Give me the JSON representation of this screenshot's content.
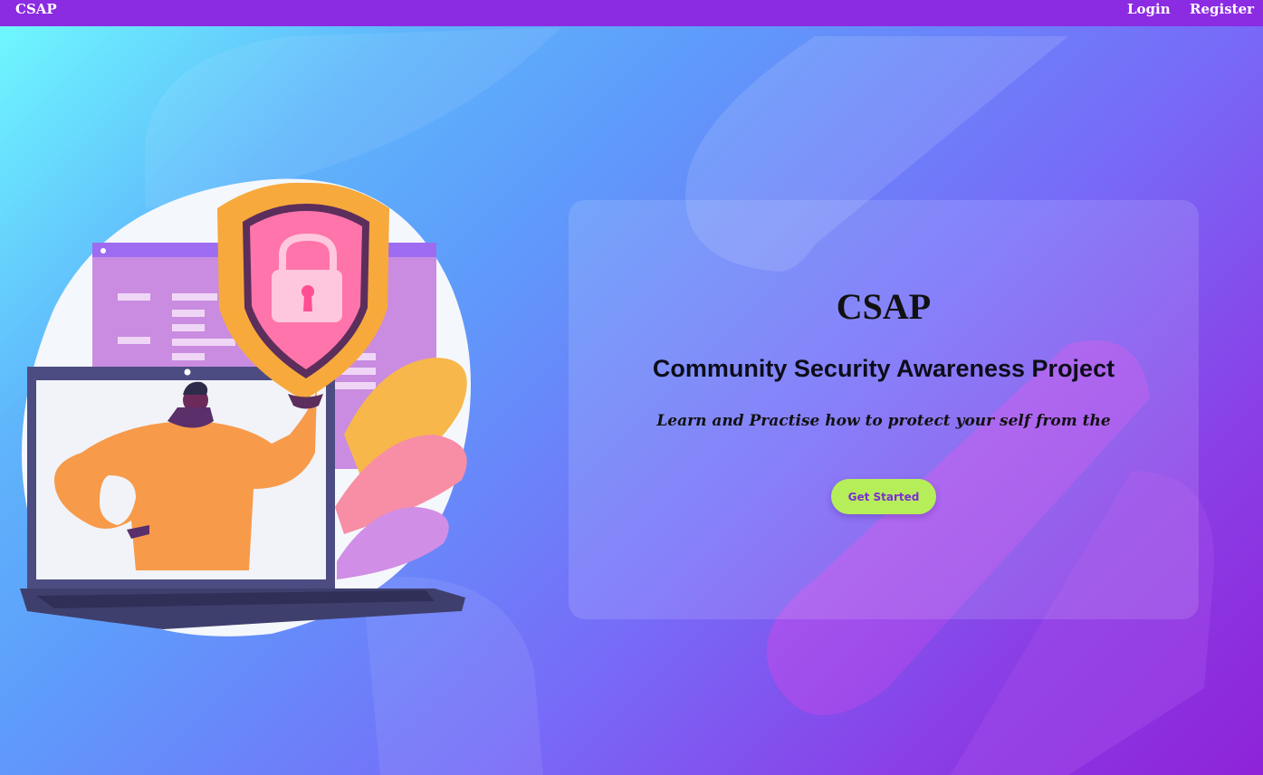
{
  "navbar": {
    "brand": "CSAP",
    "links": {
      "login": "Login",
      "register": "Register"
    }
  },
  "hero": {
    "title": "CSAP",
    "subtitle": "Community Security Awareness Project",
    "tagline": "Learn and Practise how to protect your self from the",
    "cta_label": "Get Started"
  },
  "illustration": {
    "icons": [
      "shield-icon",
      "padlock-icon",
      "laptop-icon",
      "person-icon",
      "leaf-icon"
    ]
  },
  "colors": {
    "navbar": "#8b2be2",
    "cta_bg": "#b6ee5a",
    "cta_text": "#7a2fd0",
    "shield_outer": "#f7a93c",
    "shield_inner": "#ff6fa8"
  }
}
